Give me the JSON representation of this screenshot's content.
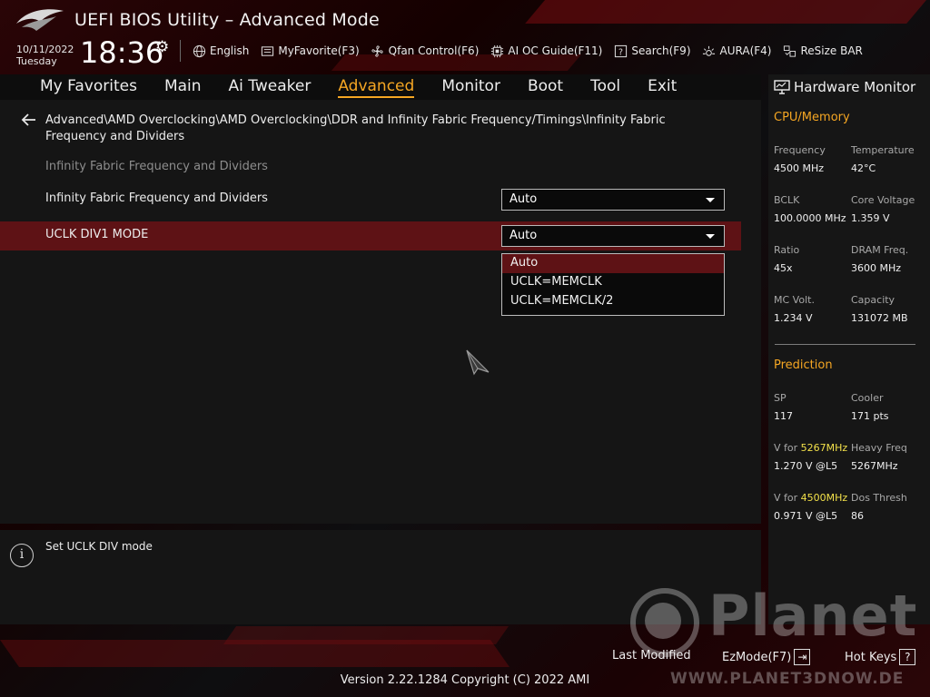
{
  "header": {
    "title": "UEFI BIOS Utility – Advanced Mode",
    "date": "10/11/2022",
    "weekday": "Tuesday",
    "time": "18:36",
    "tools": [
      {
        "label": "English",
        "icon": "globe-icon"
      },
      {
        "label": "MyFavorite(F3)",
        "icon": "favorite-icon"
      },
      {
        "label": "Qfan Control(F6)",
        "icon": "fan-icon"
      },
      {
        "label": "AI OC Guide(F11)",
        "icon": "chip-icon"
      },
      {
        "label": "Search(F9)",
        "icon": "search-icon"
      },
      {
        "label": "AURA(F4)",
        "icon": "aura-icon"
      },
      {
        "label": "ReSize BAR",
        "icon": "resize-bar-icon"
      }
    ]
  },
  "nav": {
    "tabs": [
      "My Favorites",
      "Main",
      "Ai Tweaker",
      "Advanced",
      "Monitor",
      "Boot",
      "Tool",
      "Exit"
    ],
    "active": "Advanced"
  },
  "main": {
    "breadcrumb": "Advanced\\AMD Overclocking\\AMD Overclocking\\DDR and Infinity Fabric Frequency/Timings\\Infinity Fabric Frequency and Dividers",
    "section_header": "Infinity Fabric Frequency and Dividers",
    "settings": [
      {
        "label": "Infinity Fabric Frequency and Dividers",
        "value": "Auto"
      },
      {
        "label": "UCLK DIV1 MODE",
        "value": "Auto"
      }
    ],
    "dropdown_options": [
      "Auto",
      "UCLK=MEMCLK",
      "UCLK=MEMCLK/2"
    ]
  },
  "help": {
    "text": "Set UCLK DIV mode"
  },
  "hw_monitor": {
    "title": "Hardware Monitor",
    "cpu_memory": {
      "title": "CPU/Memory",
      "frequency_label": "Frequency",
      "frequency": "4500 MHz",
      "temperature_label": "Temperature",
      "temperature": "42°C",
      "bclk_label": "BCLK",
      "bclk": "100.0000 MHz",
      "core_voltage_label": "Core Voltage",
      "core_voltage": "1.359 V",
      "ratio_label": "Ratio",
      "ratio": "45x",
      "dram_freq_label": "DRAM Freq.",
      "dram_freq": "3600 MHz",
      "mc_volt_label": "MC Volt.",
      "mc_volt": "1.234 V",
      "capacity_label": "Capacity",
      "capacity": "131072 MB"
    },
    "prediction": {
      "title": "Prediction",
      "sp_label": "SP",
      "sp": "117",
      "cooler_label": "Cooler",
      "cooler": "171 pts",
      "v_for_label": "V for",
      "v_for_1_freq": "5267MHz",
      "v_for_1": "1.270 V @L5",
      "heavy_freq_label": "Heavy Freq",
      "heavy_freq": "5267MHz",
      "v_for_2_freq": "4500MHz",
      "v_for_2": "0.971 V @L5",
      "dos_thresh_label": "Dos Thresh",
      "dos_thresh": "86"
    }
  },
  "footer": {
    "last_modified": "Last Modified",
    "ezmode": "EzMode(F7)",
    "hotkeys": "Hot Keys",
    "hotkeys_key": "?",
    "version": "Version 2.22.1284 Copyright (C) 2022 AMI"
  },
  "watermark": {
    "word": "Planet",
    "url": "WWW.PLANET3DNOW.DE"
  },
  "colors": {
    "accent": "#f5a623",
    "highlight": "#5e1215",
    "value_yellow": "#f2e04a"
  }
}
